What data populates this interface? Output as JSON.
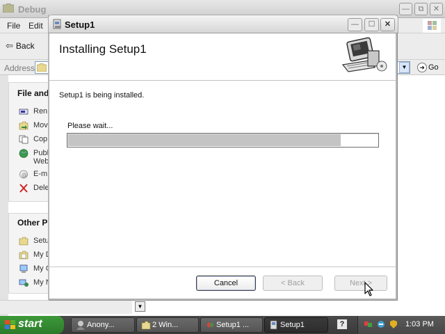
{
  "explorer": {
    "title": "Debug",
    "menu": [
      "File",
      "Edit"
    ],
    "back_label": "Back",
    "address_label": "Address",
    "go_label": "Go",
    "task_pane": {
      "file_tasks_header": "File and",
      "file_tasks": [
        {
          "label": "Ren",
          "icon": "rename-icon"
        },
        {
          "label": "Mov",
          "icon": "move-icon"
        },
        {
          "label": "Cop",
          "icon": "copy-icon"
        },
        {
          "label": "Publ",
          "label2": "Web",
          "icon": "publish-web-icon"
        },
        {
          "label": "E-m",
          "icon": "email-icon"
        },
        {
          "label": "Dele",
          "icon": "delete-icon"
        }
      ],
      "other_places_header": "Other P",
      "other_places": [
        {
          "label": "Setu",
          "icon": "folder-icon"
        },
        {
          "label": "My D",
          "icon": "my-documents-icon"
        },
        {
          "label": "My C",
          "icon": "my-computer-icon"
        },
        {
          "label": "My N",
          "icon": "my-network-icon"
        }
      ]
    }
  },
  "dialog": {
    "title": "Setup1",
    "heading": "Installing Setup1",
    "status_text": "Setup1 is being installed.",
    "wait_text": "Please wait...",
    "progress_fraction": 0.88,
    "buttons": {
      "cancel": "Cancel",
      "back": "< Back",
      "next": "Next >"
    }
  },
  "taskbar": {
    "start_label": "start",
    "tasks": [
      {
        "label": "Anony...",
        "icon": "anonymous-app-icon",
        "active": false
      },
      {
        "label": "2 Win...",
        "icon": "folder-group-icon",
        "active": false
      },
      {
        "label": "Setup1 ...",
        "icon": "setup-project-icon",
        "active": false
      },
      {
        "label": "Setup1",
        "icon": "setup-installer-icon",
        "active": true
      }
    ],
    "clock": "1:03 PM"
  },
  "colors": {
    "start_green": "#3d9a3a",
    "progress_fill": "#c4c4c4",
    "taskbar": "#454545"
  }
}
